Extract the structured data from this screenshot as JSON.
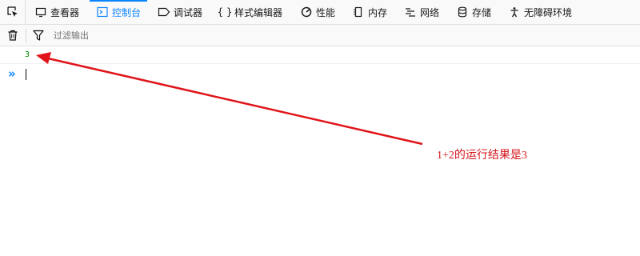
{
  "toolbar": {
    "tabs": [
      {
        "label": "查看器",
        "icon": "inspector-icon"
      },
      {
        "label": "控制台",
        "icon": "console-icon",
        "active": true
      },
      {
        "label": "调试器",
        "icon": "debugger-icon"
      },
      {
        "label": "样式编辑器",
        "icon": "style-editor-icon"
      },
      {
        "label": "性能",
        "icon": "performance-icon"
      },
      {
        "label": "内存",
        "icon": "memory-icon"
      },
      {
        "label": "网络",
        "icon": "network-icon"
      },
      {
        "label": "存储",
        "icon": "storage-icon"
      },
      {
        "label": "无障碍环境",
        "icon": "accessibility-icon"
      }
    ]
  },
  "filter": {
    "placeholder": "过滤输出"
  },
  "console": {
    "output": "3",
    "prompt": "»"
  },
  "annotation": {
    "text": "1+2的运行结果是3",
    "color": "#d4151b"
  },
  "colors": {
    "accent": "#0a84ff",
    "result": "#058b00"
  }
}
